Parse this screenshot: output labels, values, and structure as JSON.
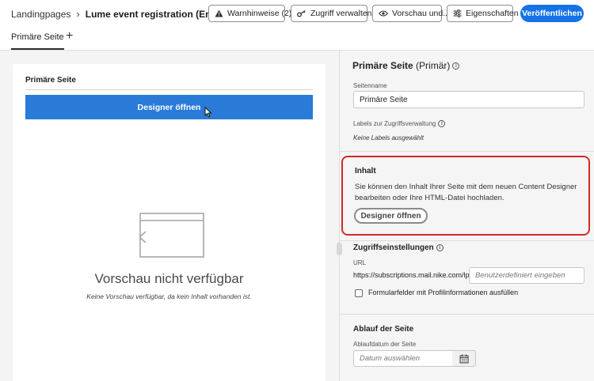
{
  "header": {
    "breadcrumb_root": "Landingpages",
    "breadcrumb_separator": "›",
    "title": "Lume event registration (Entwurf)",
    "buttons": {
      "warnings": "Warnhinweise (2)",
      "access": "Zugriff verwalten",
      "preview": "Vorschau und...",
      "properties": "Eigenschaften",
      "publish": "Veröffentlichen"
    }
  },
  "tabs": {
    "active": "Primäre Seite",
    "add": "+"
  },
  "canvas": {
    "title": "Primäre Seite",
    "designer_button": "Designer öffnen",
    "preview_title": "Vorschau nicht verfügbar",
    "preview_subtitle": "Keine Vorschau verfügbar, da kein Inhalt vorhanden ist."
  },
  "panel": {
    "title_bold": "Primäre Seite",
    "title_suffix": " (Primär)",
    "info_glyph": "i",
    "page_name_label": "Seitenname",
    "page_name_value": "Primäre Seite",
    "labels_title": "Labels zur Zugriffsverwaltung",
    "labels_empty": "Keine Labels ausgewählt",
    "content": {
      "title": "Inhalt",
      "text": "Sie können den Inhalt Ihrer Seite mit dem neuen Content Designer bearbeiten oder Ihre HTML-Datei hochladen.",
      "button": "Designer öffnen"
    },
    "access": {
      "title": "Zugriffseinstellungen",
      "url_label": "URL",
      "url_prefix": "https://subscriptions.mail.nike.com/lp/",
      "url_placeholder": "Benutzerdefiniert eingeben",
      "checkbox_label": "Formularfelder mit Profilinformationen ausfüllen",
      "checkbox_checked": false
    },
    "expiry": {
      "title": "Ablauf der Seite",
      "date_label": "Ablaufdatum der Seite",
      "date_placeholder": "Datum auswählen"
    }
  },
  "colors": {
    "primary": "#1473e6",
    "designer_bar": "#2a7bd8",
    "highlight": "#d22a2a"
  }
}
